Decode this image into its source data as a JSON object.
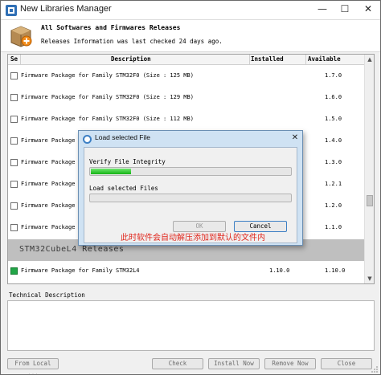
{
  "window": {
    "title": "New Libraries Manager",
    "minimize_glyph": "—",
    "maximize_glyph": "☐",
    "close_glyph": "✕"
  },
  "header": {
    "title": "All Softwares and Firmwares Releases",
    "subtitle": "Releases Information was last checked 24 days ago.",
    "icon": "package-box-icon"
  },
  "table": {
    "columns": {
      "select": "Se",
      "description": "Description",
      "installed": "Installed",
      "available": "Available"
    },
    "rows": [
      {
        "description": "Firmware Package for Family STM32F0 (Size : 125 MB)",
        "installed": "",
        "available": "1.7.0"
      },
      {
        "description": "Firmware Package for Family STM32F0 (Size : 129 MB)",
        "installed": "",
        "available": "1.6.0"
      },
      {
        "description": "Firmware Package for Family STM32F0 (Size : 112 MB)",
        "installed": "",
        "available": "1.5.0"
      },
      {
        "description": "Firmware Package fo",
        "installed": "",
        "available": "1.4.0"
      },
      {
        "description": "Firmware Package fo",
        "installed": "",
        "available": "1.3.0"
      },
      {
        "description": "Firmware Package fo",
        "installed": "",
        "available": "1.2.1"
      },
      {
        "description": "Firmware Package fo",
        "installed": "",
        "available": "1.2.0"
      },
      {
        "description": "Firmware Package fo",
        "installed": "",
        "available": "1.1.0"
      }
    ],
    "group_label": "STM32CubeL4 Releases",
    "group_row": {
      "description": "Firmware Package for Family STM32L4",
      "installed": "1.10.0",
      "available": "1.10.0"
    }
  },
  "technical_description": {
    "label": "Technical Description"
  },
  "buttons": {
    "from_local": "From Local ...",
    "check": "Check",
    "install_now": "Install Now",
    "remove_now": "Remove Now",
    "close": "Close"
  },
  "dialog": {
    "title": "Load selected File",
    "close_glyph": "✕",
    "verify_label": "Verify File Integrity",
    "verify_progress": 0.2,
    "load_label": "Load selected Files",
    "load_progress": 0,
    "ok_label": "OK",
    "cancel_label": "Cancel"
  },
  "annotation": "此时软件会自动解压添加到默认的文件内",
  "colors": {
    "progress_green": "#22c322",
    "installed_green": "#22a648",
    "annotation_red": "#e1261c",
    "dialog_frame": "#cfe2f3"
  }
}
